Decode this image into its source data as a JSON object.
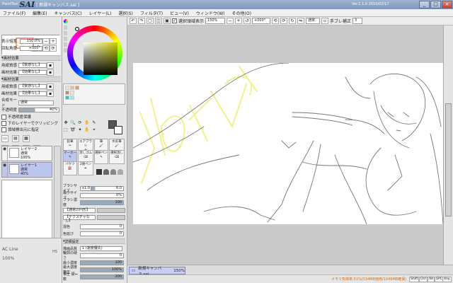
{
  "title": {
    "logo_small": "PaintTool",
    "logo_main": "SAI",
    "window_title": "[ 新規キャンバス.sai ]",
    "version": "Ver.1.1.0 2010/02/17"
  },
  "menu": [
    "ファイル(F)",
    "編集(E)",
    "キャンバス(C)",
    "レイヤー(L)",
    "選択(S)",
    "フィルタ(T)",
    "ビュー(V)",
    "ウィンドウ(W)",
    "その他(O)"
  ],
  "toolbar": {
    "selection_label": "選択領域表示",
    "zoom": "150%",
    "rotation": "+000°",
    "blend": "通常",
    "stabilizer_label": "手ブレ補正",
    "stabilizer_value": "3"
  },
  "navigator": {
    "zoom_label": "表示倍率",
    "zoom_value": "150.0%",
    "angle_label": "回転角度",
    "angle_value": "+000°"
  },
  "paper_effect": {
    "header": "画材効果",
    "texture_label": "用紙質感",
    "texture_value": "【質感なし】",
    "effect_label": "画材効果",
    "effect_value": "【効果なし】"
  },
  "layer_effect": {
    "header": "画材効果",
    "texture_label": "用紙質感",
    "texture_value": "【質感なし】",
    "effect_label": "画材効果",
    "effect_value": "【効果なし】"
  },
  "layer_props": {
    "mode_label": "合成モード",
    "mode_value": "通常",
    "opacity_label": "不透明度",
    "opacity_value": "40%",
    "protect_label": "不透明度保護",
    "clip_label": "下のレイヤーでクリッピング",
    "source_label": "領域検出元に指定"
  },
  "layers": [
    {
      "name": "レイヤー2",
      "mode": "通常",
      "opacity": "100%"
    },
    {
      "name": "レイヤー1",
      "mode": "通常",
      "opacity": "40%"
    }
  ],
  "footer_left": {
    "ac_line": "AC Line",
    "percent": "100%",
    "hs": "HS"
  },
  "tool_groups": {
    "pencil": "鉛筆",
    "airbrush": "エアブラシ",
    "brush": "筆",
    "watercolor": "水彩筆"
  },
  "tools": [
    "マーカー",
    "消しゴム",
    "選択ペン",
    "選択消し",
    "バケツ",
    "2値ペン"
  ],
  "brush": {
    "size_label": "ブラシサイズ",
    "size_mult": "x1.0",
    "size_value": "6.0",
    "min_size_label": "最小サイズ",
    "min_size_value": "0%",
    "density_label": "ブラシ濃度",
    "density_value": "100",
    "shape_value": "【通常の円形】",
    "texture_value": "【テクスチャなし】",
    "mix_label": "混色",
    "mix_value": "0",
    "dilute_label": "色延び",
    "dilute_value": "0"
  },
  "detail": {
    "header": "詳細設定",
    "quality_label": "描画品質",
    "quality_value": "1 (速度優先)",
    "hardness_label": "輪郭の硬さ",
    "hardness_value": "0",
    "min_density_label": "最小濃度",
    "min_density_value": "100",
    "max_pressure_label": "最大濃度筆圧",
    "max_pressure_value": "100%",
    "pressure_label": "筆圧 硬⇔軟",
    "pressure_value": "200"
  },
  "tab": {
    "name": "新規キャンバス.sai",
    "zoom": "150%"
  },
  "status": {
    "memory": "メモリ負荷率:51%(534MB使用/1049MB確保)",
    "keys": [
      "Shift",
      "Ctrl",
      "Alt",
      "SPC",
      "Any"
    ]
  },
  "colors": {
    "accent": "#7e98bd",
    "selection": "#bcc6ee",
    "sketch_yellow": "#f2f28a"
  }
}
